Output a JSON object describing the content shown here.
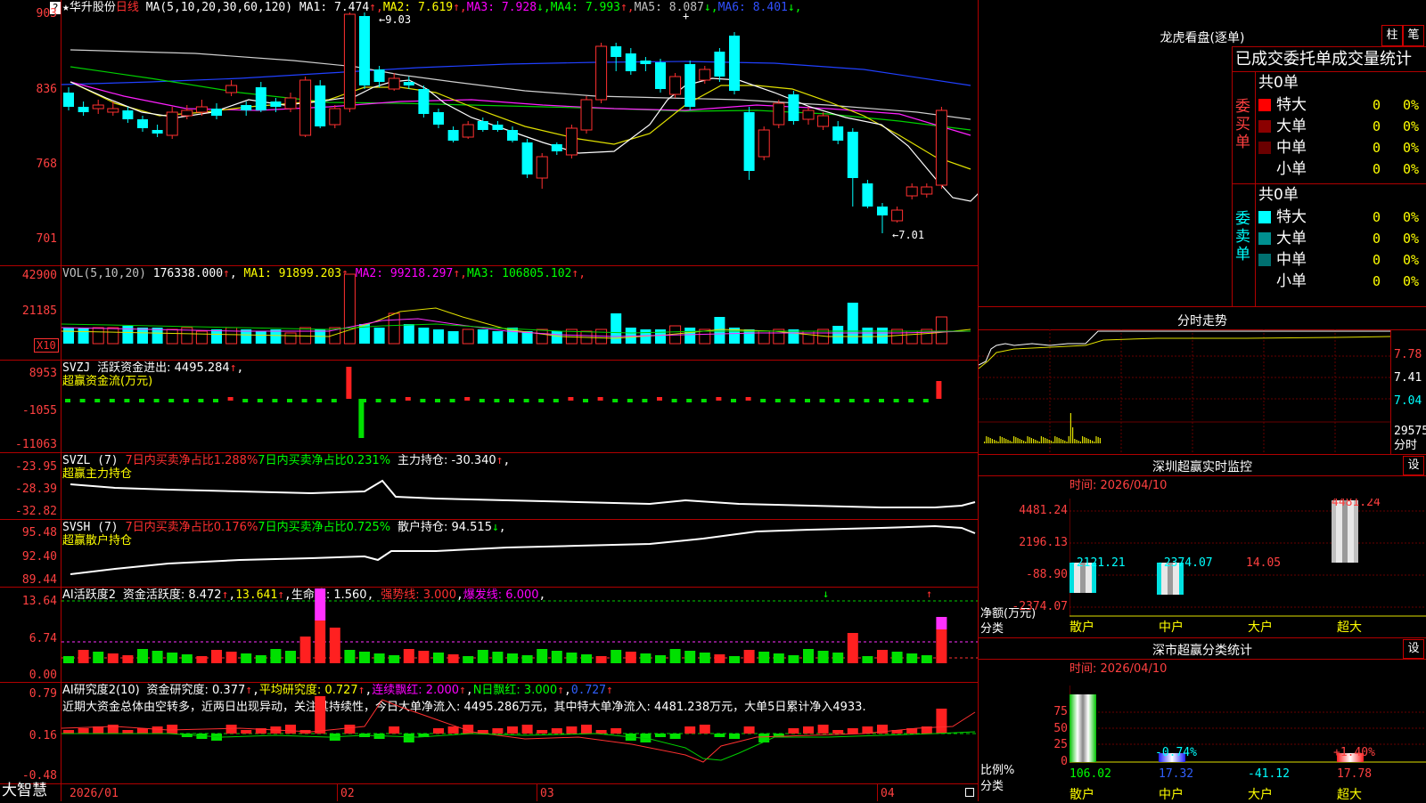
{
  "main_chart": {
    "star": "★",
    "stock_name": "华升股份",
    "period": "日线",
    "ma_params": "MA(5,10,20,30,60,120)",
    "ma_items": [
      {
        "label": "MA1:",
        "value": "7.474",
        "arrow": "↑",
        "color": "#ffffff"
      },
      {
        "label": "MA2:",
        "value": "7.619",
        "arrow": "↑",
        "color": "#ffff00"
      },
      {
        "label": "MA3:",
        "value": "7.928",
        "arrow": "↓",
        "color": "#ff00ff"
      },
      {
        "label": "MA4:",
        "value": "7.993",
        "arrow": "↑",
        "color": "#00ff00"
      },
      {
        "label": "MA5:",
        "value": "8.087",
        "arrow": "↓",
        "color": "#c0c0c0"
      },
      {
        "label": "MA6:",
        "value": "8.401",
        "arrow": "↓",
        "color": "#3050ff"
      }
    ],
    "y_labels": [
      "903",
      "836",
      "768",
      "701"
    ],
    "high_label": "9.03",
    "low_label": "7.01",
    "corner_marker": "?"
  },
  "vol_panel": {
    "header": "VOL(5,10,20)",
    "value": "176338.000",
    "arrow": "↑",
    "items": [
      {
        "label": "MA1:",
        "value": "91899.203",
        "arrow": "↑",
        "color": "#ffff00"
      },
      {
        "label": "MA2:",
        "value": "99218.297",
        "arrow": "↑",
        "color": "#ff00ff"
      },
      {
        "label": "MA3:",
        "value": "106805.102",
        "arrow": "↑",
        "color": "#00ff00"
      }
    ],
    "y_labels": [
      "42900",
      "21185"
    ],
    "unit": "X10"
  },
  "svzj_panel": {
    "header": "SVZJ",
    "line1": "活跃资金进出: 4495.284",
    "arrow": "↑",
    "line2": "超赢资金流(万元)",
    "y_labels": [
      "8953",
      "-1055",
      "-11063"
    ]
  },
  "svzl_panel": {
    "header": "SVZL (7)",
    "text1": "7日内买卖净占比1.288%",
    "text2": "7日内买卖净占比0.231%",
    "text3": "主力持仓: -30.340",
    "arrow": "↑",
    "line2": "超赢主力持仓",
    "y_labels": [
      "-23.95",
      "-28.39",
      "-32.82"
    ]
  },
  "svsh_panel": {
    "header": "SVSH (7)",
    "text1": "7日内买卖净占比0.176%",
    "text2": "7日内买卖净占比0.725%",
    "text3": "散户持仓: 94.515",
    "arrow": "↓",
    "line2": "超赢散户持仓",
    "y_labels": [
      "95.48",
      "92.40",
      "89.44"
    ]
  },
  "ai_active_panel": {
    "header": "AI活跃度2",
    "t1": "资金活跃度: 8.472",
    "t2": "13.641",
    "t3": "生命线: 1.560",
    "t4": "强势线: 3.000",
    "t5": "爆发线: 6.000",
    "y_labels": [
      "13.64",
      "6.74",
      "0.00"
    ]
  },
  "ai_research_panel": {
    "header": "AI研究度2(10)",
    "t1": "资金研究度: 0.377",
    "t2": "平均研究度: 0.727",
    "t3": "连续飘红: 2.000",
    "t4": "N日飘红: 3.000",
    "t5": "0.727",
    "summary": "近期大资金总体由空转多，近两日出现异动，关注其持续性，今日大单净流入: 4495.286万元，其中特大单净流入: 4481.238万元，大单5日累计净入4933.",
    "y_labels": [
      "0.79",
      "0.16",
      "-0.48"
    ]
  },
  "bottom_axis": {
    "brand": "大智慧",
    "labels": [
      "2026/01",
      "02",
      "03",
      "04"
    ]
  },
  "right_panel": {
    "dragon_title": "龙虎看盘(逐单)",
    "btn_bar": "柱",
    "btn_pen": "笔",
    "stats_title": "已成交委托单成交量统计",
    "buy_side": {
      "side_label": "委买单",
      "total": "共0单",
      "rows": [
        {
          "name": "特大",
          "value": "0",
          "pct": "0%",
          "color": "#ff0000"
        },
        {
          "name": "大单",
          "value": "0",
          "pct": "0%",
          "color": "#8b0000"
        },
        {
          "name": "中单",
          "value": "0",
          "pct": "0%",
          "color": "#6a0000"
        },
        {
          "name": "小单",
          "value": "0",
          "pct": "0%",
          "color": ""
        }
      ]
    },
    "sell_side": {
      "side_label": "委卖单",
      "total": "共0单",
      "rows": [
        {
          "name": "特大",
          "value": "0",
          "pct": "0%",
          "color": "#00ffff"
        },
        {
          "name": "大单",
          "value": "0",
          "pct": "0%",
          "color": "#009090"
        },
        {
          "name": "中单",
          "value": "0",
          "pct": "0%",
          "color": "#007070"
        },
        {
          "name": "小单",
          "value": "0",
          "pct": "0%",
          "color": ""
        }
      ]
    },
    "intraday": {
      "title": "分时走势",
      "prices": [
        "7.78",
        "7.41",
        "7.04"
      ],
      "volume": "29575",
      "vol_label": "分时"
    },
    "monitor": {
      "title": "深圳超赢实时监控",
      "set_btn": "设",
      "time_label": "时间: 2026/04/10",
      "y_labels": [
        "4481.24",
        "2196.13",
        "-88.90",
        "-2374.07"
      ],
      "y_axis_label": "净额(万元)",
      "x_axis_label": "分类",
      "categories": [
        "散户",
        "中户",
        "大户",
        "超大"
      ],
      "values": [
        "-2121.21",
        "-2374.07",
        "14.05",
        "4481.24"
      ]
    },
    "classify": {
      "title": "深市超赢分类统计",
      "set_btn": "设",
      "time_label": "时间: 2026/04/10",
      "y_labels": [
        "75",
        "50",
        "25",
        "0"
      ],
      "y_axis_label": "比例%",
      "x_axis_label": "分类",
      "categories": [
        "散户",
        "中户",
        "大户",
        "超大"
      ],
      "bar_labels": [
        "",
        "-0.74%",
        "",
        "+1.40%"
      ],
      "values": [
        "106.02",
        "17.32",
        "-41.12",
        "17.78"
      ]
    }
  }
}
